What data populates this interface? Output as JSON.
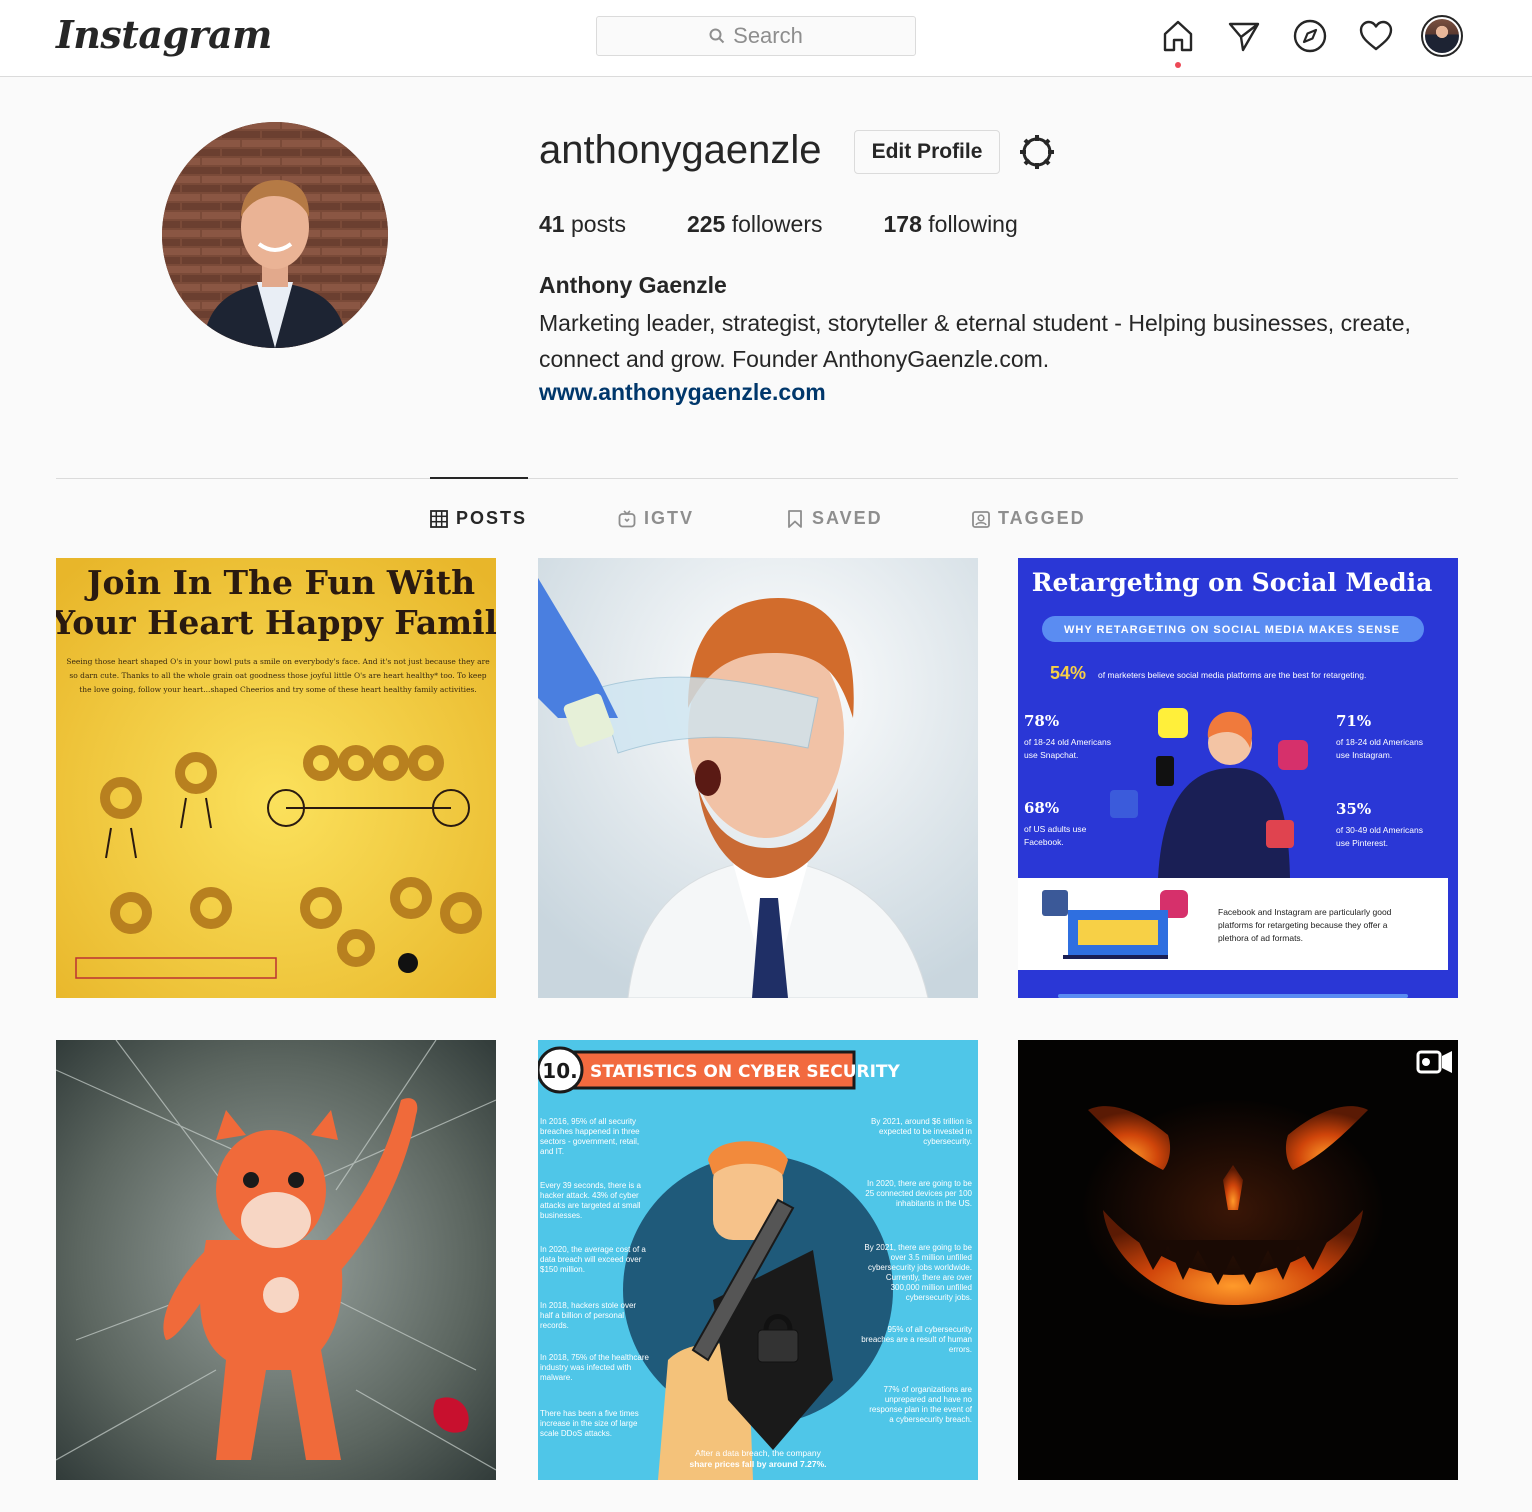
{
  "app": {
    "logo_text": "Instagram"
  },
  "search": {
    "placeholder": "Search"
  },
  "nav": {
    "icons": [
      "home-icon",
      "direct-icon",
      "explore-icon",
      "activity-icon",
      "profile-avatar"
    ],
    "has_notification": true
  },
  "profile": {
    "username": "anthonygaenzle",
    "edit_label": "Edit Profile",
    "posts_count": "41",
    "posts_label": "posts",
    "followers_count": "225",
    "followers_label": "followers",
    "following_count": "178",
    "following_label": "following",
    "full_name": "Anthony Gaenzle",
    "bio": "Marketing leader, strategist, storyteller & eternal student - Helping businesses, create, connect and grow. Founder AnthonyGaenzle.com.",
    "website": "www.anthonygaenzle.com"
  },
  "tabs": [
    {
      "label": "POSTS",
      "icon": "grid-icon",
      "active": true
    },
    {
      "label": "IGTV",
      "icon": "igtv-icon",
      "active": false
    },
    {
      "label": "SAVED",
      "icon": "bookmark-icon",
      "active": false
    },
    {
      "label": "TAGGED",
      "icon": "tagged-icon",
      "active": false
    }
  ],
  "posts": [
    {
      "title_line1": "Join In The Fun With",
      "title_line2": "Your Heart Happy Family",
      "body_line1": "Seeing those heart shaped O's in your bowl puts a smile on everybody's face. And it's not just because they are",
      "body_line2": "so darn cute. Thanks to all the whole grain oat goodness those joyful little O's are heart healthy* too. To keep",
      "body_line3": "the love going, follow your heart...shaped Cheerios and try some of these heart healthy family activities."
    },
    {
      "description": "photo"
    },
    {
      "title": "Retargeting on Social Media",
      "subtitle": "WHY RETARGETING ON SOCIAL MEDIA MAKES SENSE",
      "stat_main_value": "54%",
      "stat_main_text": "of marketers believe social media platforms are the best for retargeting.",
      "stats": [
        {
          "value": "78%",
          "line1": "of 18-24 old Americans",
          "line2": "use Snapchat."
        },
        {
          "value": "71%",
          "line1": "of 18-24 old Americans",
          "line2": "use Instagram."
        },
        {
          "value": "68%",
          "line1": "of US adults use",
          "line2": "Facebook."
        },
        {
          "value": "35%",
          "line1": "of 30-49 old Americans",
          "line2": "use Pinterest."
        }
      ],
      "footer_line1": "Facebook and Instagram are particularly good",
      "footer_line2": "platforms for retargeting because they offer a",
      "footer_line3": "plethora of ad formats."
    },
    {
      "description": "photo"
    },
    {
      "number": "10.",
      "title": "STATISTICS ON CYBER SECURITY",
      "left_facts": [
        "In 2016, 95% of all security breaches happened in three sectors - government, retail, and IT.",
        "Every 39 seconds, there is a hacker attack. 43% of cyber attacks are targeted at small businesses.",
        "In 2020, the average cost of a data breach will exceed over $150 million.",
        "In 2018, hackers stole over half a billion of personal records.",
        "In 2018, 75% of the healthcare industry was infected with malware.",
        "There has been a five times increase in the size of large scale DDoS attacks."
      ],
      "right_facts": [
        "By 2021, around $6 trillion is expected to be invested in cybersecurity.",
        "In 2020, there are going to be 25 connected devices per 100 inhabitants in the US.",
        "By 2021, there are going to be over 3.5 million unfilled cybersecurity jobs worldwide. Currently, there are over 300,000 million unfilled cybersecurity jobs.",
        "95% of all cybersecurity breaches are a result of human errors.",
        "77% of organizations are unprepared and have no response plan in the event of a cybersecurity breach."
      ],
      "bottom_line1": "After a data breach, the company",
      "bottom_line2": "share prices fall by around 7.27%."
    },
    {
      "description": "photo",
      "video_icon": "video-icon"
    }
  ],
  "colors": {
    "link": "#00376b",
    "notification": "#ed4956",
    "retarget_bg": "#2a37d6",
    "cyber_bg": "#4fc6e8",
    "cyber_banner": "#f26a3f"
  }
}
